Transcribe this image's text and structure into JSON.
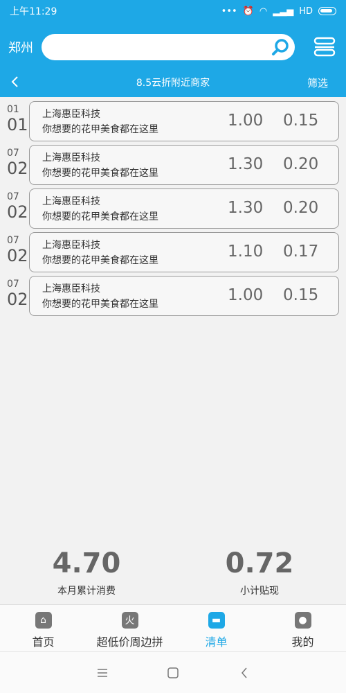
{
  "status_bar": {
    "time": "上午11:29",
    "network": "HD"
  },
  "header": {
    "city": "郑州",
    "search": {
      "value": "",
      "placeholder": ""
    },
    "title": "8.5云折附近商家",
    "filter_label": "筛选"
  },
  "list": [
    {
      "month": "01",
      "day": "01",
      "name": "上海惠臣科技",
      "desc": "你想要的花甲美食都在这里",
      "value1": "1.00",
      "value2": "0.15"
    },
    {
      "month": "07",
      "day": "02",
      "name": "上海惠臣科技",
      "desc": "你想要的花甲美食都在这里",
      "value1": "1.30",
      "value2": "0.20"
    },
    {
      "month": "07",
      "day": "02",
      "name": "上海惠臣科技",
      "desc": "你想要的花甲美食都在这里",
      "value1": "1.30",
      "value2": "0.20"
    },
    {
      "month": "07",
      "day": "02",
      "name": "上海惠臣科技",
      "desc": "你想要的花甲美食都在这里",
      "value1": "1.10",
      "value2": "0.17"
    },
    {
      "month": "07",
      "day": "02",
      "name": "上海惠臣科技",
      "desc": "你想要的花甲美食都在这里",
      "value1": "1.00",
      "value2": "0.15"
    }
  ],
  "totals": {
    "monthly_spend": {
      "value": "4.70",
      "label": "本月累计消费"
    },
    "cashback": {
      "value": "0.72",
      "label": "小计贴现"
    }
  },
  "tabs": [
    {
      "label": "首页",
      "icon": "home-icon",
      "glyph": "⌂"
    },
    {
      "label": "超低价周边拼",
      "icon": "fire-icon",
      "glyph": "火"
    },
    {
      "label": "清单",
      "icon": "list-icon",
      "glyph": "▬"
    },
    {
      "label": "我的",
      "icon": "profile-icon",
      "glyph": "●"
    }
  ],
  "active_tab": 2,
  "colors": {
    "primary": "#1ea8e6",
    "value_text": "#666666"
  }
}
